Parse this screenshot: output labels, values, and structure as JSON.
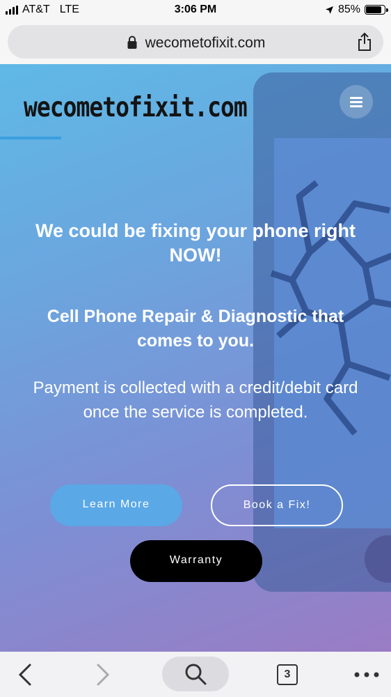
{
  "status_bar": {
    "carrier": "AT&T",
    "network": "LTE",
    "time": "3:06 PM",
    "battery_percent": "85%",
    "battery_level": 0.85
  },
  "browser": {
    "url": "wecometofixit.com",
    "tab_count": "3"
  },
  "hero": {
    "logo": "wecometofixit.com",
    "headline": "We could be fixing your phone right NOW!",
    "subhead": "Cell Phone Repair & Diagnostic that comes to you.",
    "payment_note": "Payment is collected with a credit/debit card once the service is completed.",
    "buttons": {
      "learn_more": "Learn More",
      "book_fix": "Book a Fix!",
      "warranty": "Warranty"
    }
  },
  "icons": {
    "signal": "signal-bars-icon",
    "location": "location-arrow-icon",
    "battery": "battery-icon",
    "lock": "lock-icon",
    "share": "share-icon",
    "menu": "hamburger-menu-icon",
    "back": "chevron-left-icon",
    "forward": "chevron-right-icon",
    "search": "search-icon",
    "more": "more-dots-icon"
  },
  "colors": {
    "learn_more_bg": "#5aa8e6",
    "warranty_bg": "#000000",
    "accent_line": "#3a9fe0"
  }
}
